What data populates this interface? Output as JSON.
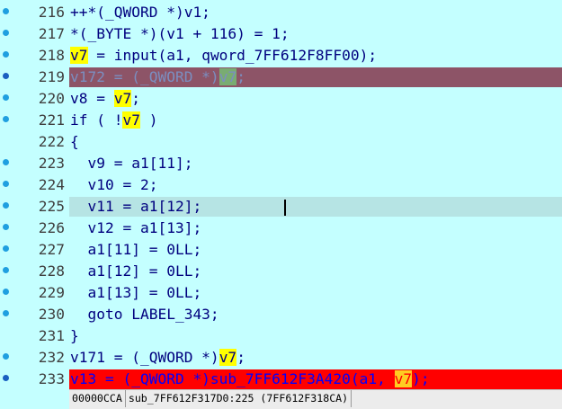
{
  "window": {
    "view": "Pseudocode"
  },
  "lines": [
    {
      "num": "216",
      "marker": "dot",
      "style": "normal",
      "parts": [
        {
          "t": "++*(_QWORD *)v1;"
        }
      ]
    },
    {
      "num": "217",
      "marker": "dot",
      "style": "normal",
      "parts": [
        {
          "t": "*(_BYTE *)(v1 + 116) = 1;"
        }
      ]
    },
    {
      "num": "218",
      "marker": "dot",
      "style": "normal",
      "parts": [
        {
          "t": "v7",
          "hl": true
        },
        {
          "t": " = input(a1, qword_7FF612F8FF00);"
        }
      ]
    },
    {
      "num": "219",
      "marker": "breakpoint",
      "style": "breakpoint-disabled",
      "parts": [
        {
          "t": "v172 = (_QWORD *)"
        },
        {
          "t": "v7",
          "hl": true
        },
        {
          "t": ";"
        }
      ]
    },
    {
      "num": "220",
      "marker": "dot",
      "style": "normal",
      "parts": [
        {
          "t": "v8 = "
        },
        {
          "t": "v7",
          "hl": true
        },
        {
          "t": ";"
        }
      ]
    },
    {
      "num": "221",
      "marker": "dot",
      "style": "normal",
      "parts": [
        {
          "t": "if ( !"
        },
        {
          "t": "v7",
          "hl": true
        },
        {
          "t": " )"
        }
      ]
    },
    {
      "num": "222",
      "marker": "none",
      "style": "normal",
      "parts": [
        {
          "t": "{"
        }
      ]
    },
    {
      "num": "223",
      "marker": "dot",
      "style": "normal",
      "parts": [
        {
          "t": "  v9 = a1[11];"
        }
      ]
    },
    {
      "num": "224",
      "marker": "dot",
      "style": "normal",
      "parts": [
        {
          "t": "  v10 = 2;"
        }
      ]
    },
    {
      "num": "225",
      "marker": "dot",
      "style": "current",
      "parts": [
        {
          "t": "  v11 = a1[12];"
        }
      ]
    },
    {
      "num": "226",
      "marker": "dot",
      "style": "normal",
      "parts": [
        {
          "t": "  v12 = a1[13];"
        }
      ]
    },
    {
      "num": "227",
      "marker": "dot",
      "style": "normal",
      "parts": [
        {
          "t": "  a1[11] = 0LL;"
        }
      ]
    },
    {
      "num": "228",
      "marker": "dot",
      "style": "normal",
      "parts": [
        {
          "t": "  a1[12] = 0LL;"
        }
      ]
    },
    {
      "num": "229",
      "marker": "dot",
      "style": "normal",
      "parts": [
        {
          "t": "  a1[13] = 0LL;"
        }
      ]
    },
    {
      "num": "230",
      "marker": "dot",
      "style": "normal",
      "parts": [
        {
          "t": "  goto LABEL_343;"
        }
      ]
    },
    {
      "num": "231",
      "marker": "none",
      "style": "normal",
      "parts": [
        {
          "t": "}"
        }
      ]
    },
    {
      "num": "232",
      "marker": "dot",
      "style": "normal",
      "parts": [
        {
          "t": "v171 = (_QWORD *)"
        },
        {
          "t": "v7",
          "hl": true
        },
        {
          "t": ";"
        }
      ]
    },
    {
      "num": "233",
      "marker": "breakpoint",
      "style": "breakpoint-active",
      "parts": [
        {
          "t": "v13 = (_QWORD *)sub_7FF612F3A420(a1, "
        },
        {
          "t": "v7",
          "hl": true
        },
        {
          "t": ");"
        }
      ]
    }
  ],
  "status": {
    "offset": "00000CCA",
    "location": "sub_7FF612F317D0:225 (7FF612F318CA)"
  }
}
